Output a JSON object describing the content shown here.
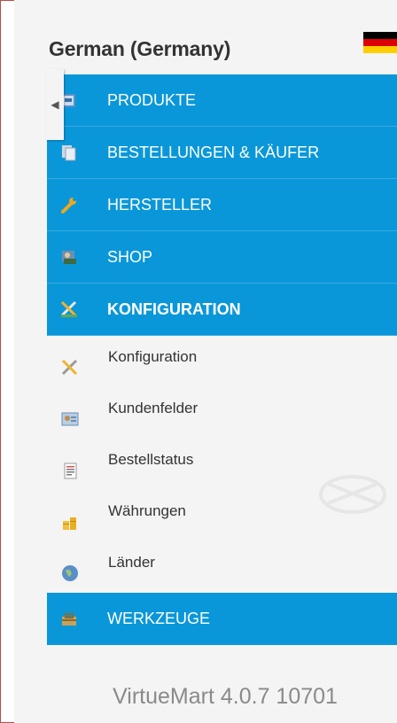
{
  "language": {
    "title": "German (Germany)"
  },
  "menu": [
    {
      "label": "PRODUKTE",
      "icon": "product-icon"
    },
    {
      "label": "BESTELLUNGEN & KÄUFER",
      "icon": "orders-icon"
    },
    {
      "label": "HERSTELLER",
      "icon": "wrench-icon"
    },
    {
      "label": "SHOP",
      "icon": "shop-icon"
    },
    {
      "label": "KONFIGURATION",
      "icon": "config-icon",
      "active": true
    }
  ],
  "submenu": [
    {
      "label": "Konfiguration",
      "icon": "config-tools-icon"
    },
    {
      "label": "Kundenfelder",
      "icon": "customer-fields-icon"
    },
    {
      "label": "Bestellstatus",
      "icon": "order-status-icon"
    },
    {
      "label": "Währungen",
      "icon": "coins-icon"
    },
    {
      "label": "Länder",
      "icon": "globe-icon"
    }
  ],
  "menu_after": {
    "label": "WERKZEUGE",
    "icon": "toolbox-icon"
  },
  "footer": {
    "version": "VirtueMart 4.0.7 10701"
  },
  "colors": {
    "accent": "#0a97d9",
    "frame": "#b94a48",
    "panel": "#f4f4f4"
  }
}
